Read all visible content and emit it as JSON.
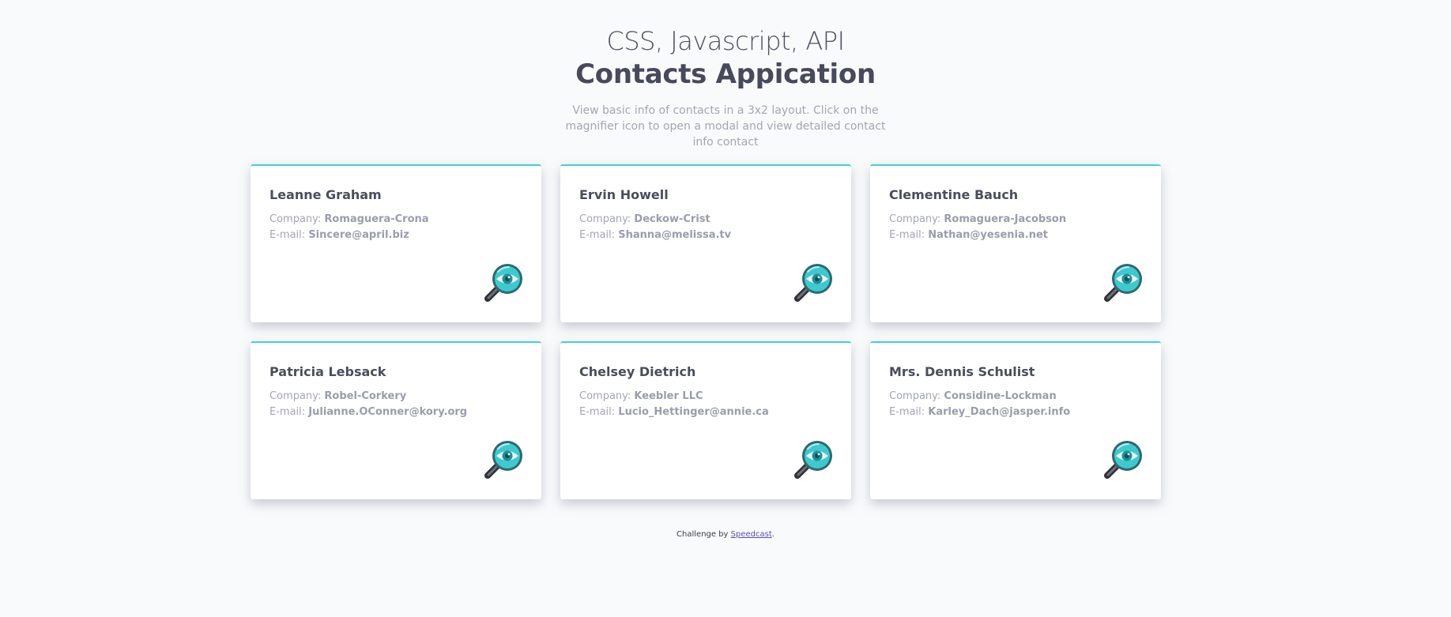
{
  "header": {
    "subtitle": "CSS, Javascript, API",
    "title": "Contacts Appication",
    "description": "View basic info of contacts in a 3x2 layout. Click on the magnifier icon to open a modal and view detailed contact info contact"
  },
  "labels": {
    "company": "Company:",
    "email": "E-mail:"
  },
  "contacts": [
    {
      "name": "Leanne Graham",
      "company": "Romaguera-Crona",
      "email": "Sincere@april.biz"
    },
    {
      "name": "Ervin Howell",
      "company": "Deckow-Crist",
      "email": "Shanna@melissa.tv"
    },
    {
      "name": "Clementine Bauch",
      "company": "Romaguera-Jacobson",
      "email": "Nathan@yesenia.net"
    },
    {
      "name": "Patricia Lebsack",
      "company": "Robel-Corkery",
      "email": "Julianne.OConner@kory.org"
    },
    {
      "name": "Chelsey Dietrich",
      "company": "Keebler LLC",
      "email": "Lucio_Hettinger@annie.ca"
    },
    {
      "name": "Mrs. Dennis Schulist",
      "company": "Considine-Lockman",
      "email": "Karley_Dach@jasper.info"
    }
  ],
  "icons": {
    "card_action": "magnifier-eye-icon"
  },
  "colors": {
    "accent": "#44d1d1",
    "background": "#f9fafb",
    "link": "#5a4fb8"
  },
  "footer": {
    "prefix": "Challenge by",
    "link_text": "Speedcast",
    "suffix": "."
  }
}
